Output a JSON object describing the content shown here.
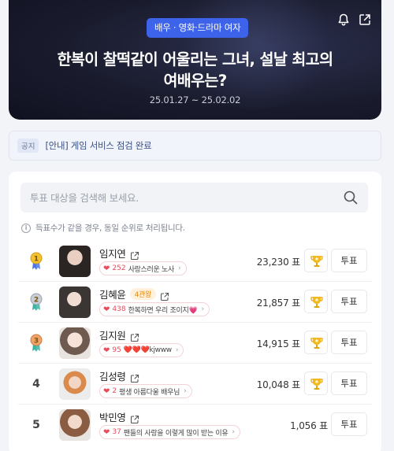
{
  "header": {
    "category": "배우 · 영화·드라마 여자",
    "title_line1": "한복이 찰떡같이 어울리는 그녀, 설날 최고의",
    "title_line2": "여배우는?",
    "period": "25.01.27 ~ 25.02.02",
    "icons": [
      "bell-icon",
      "share-icon"
    ]
  },
  "notice": {
    "tag": "공지",
    "text": "[안내] 게임 서비스 점검 완료"
  },
  "search": {
    "placeholder": "투표 대상을 검색해 보세요."
  },
  "info_text": "득표수가 같을 경우, 동일 순위로 처리됩니다.",
  "unit": "표",
  "vote_label": "투표",
  "colors": {
    "accent": "#3d63ea",
    "heart": "#e84b5c",
    "gold": "#f2b81e"
  },
  "candidates": [
    {
      "rank": "1",
      "medal": "gold",
      "name": "임지연",
      "badge": "",
      "cheer_count": "252",
      "cheer_msg": "사랑스러운 노사",
      "votes": "23,230",
      "trophy": true
    },
    {
      "rank": "2",
      "medal": "silver",
      "name": "김혜윤",
      "badge": "4관왕",
      "cheer_count": "438",
      "cheer_msg": "한복하면 우리 조이지💗",
      "votes": "21,857",
      "trophy": true
    },
    {
      "rank": "3",
      "medal": "bronze",
      "name": "김지원",
      "badge": "",
      "cheer_count": "95",
      "cheer_msg": "❤️❤️❤️kjwww",
      "votes": "14,915",
      "trophy": true
    },
    {
      "rank": "4",
      "medal": "",
      "name": "김성령",
      "badge": "",
      "cheer_count": "2",
      "cheer_msg": "평생 아름다울 배우님",
      "votes": "10,048",
      "trophy": true
    },
    {
      "rank": "5",
      "medal": "",
      "name": "박민영",
      "badge": "",
      "cheer_count": "37",
      "cheer_msg": "팬들의 사랑을 이렇게 많이 받는 이유",
      "votes": "1,056",
      "trophy": false
    }
  ]
}
